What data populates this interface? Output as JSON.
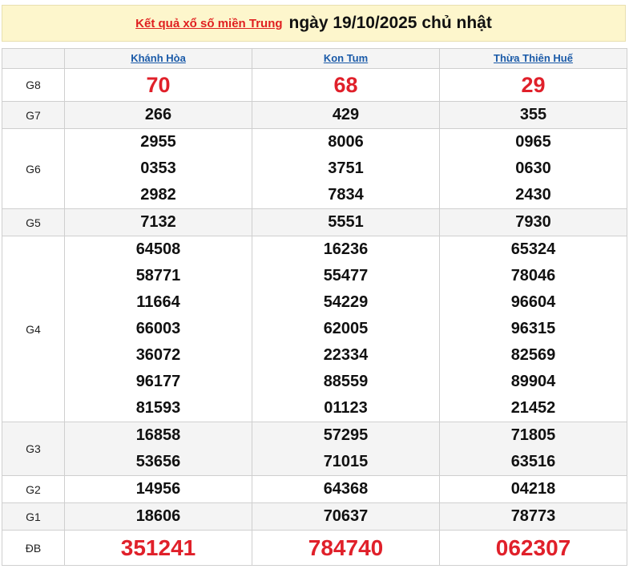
{
  "header": {
    "link_text": "Kết quả xổ số miền Trung",
    "date_text": "ngày 19/10/2025 chủ nhật"
  },
  "provinces": [
    "Khánh Hòa",
    "Kon Tum",
    "Thừa Thiên Huế"
  ],
  "rows": {
    "g8": {
      "label": "G8",
      "values": [
        "70",
        "68",
        "29"
      ]
    },
    "g7": {
      "label": "G7",
      "values": [
        "266",
        "429",
        "355"
      ]
    },
    "g6": {
      "label": "G6",
      "values": [
        [
          "2955",
          "0353",
          "2982"
        ],
        [
          "8006",
          "3751",
          "7834"
        ],
        [
          "0965",
          "0630",
          "2430"
        ]
      ]
    },
    "g5": {
      "label": "G5",
      "values": [
        "7132",
        "5551",
        "7930"
      ]
    },
    "g4": {
      "label": "G4",
      "values": [
        [
          "64508",
          "58771",
          "11664",
          "66003",
          "36072",
          "96177",
          "81593"
        ],
        [
          "16236",
          "55477",
          "54229",
          "62005",
          "22334",
          "88559",
          "01123"
        ],
        [
          "65324",
          "78046",
          "96604",
          "96315",
          "82569",
          "89904",
          "21452"
        ]
      ]
    },
    "g3": {
      "label": "G3",
      "values": [
        [
          "16858",
          "53656"
        ],
        [
          "57295",
          "71015"
        ],
        [
          "71805",
          "63516"
        ]
      ]
    },
    "g2": {
      "label": "G2",
      "values": [
        "14956",
        "64368",
        "04218"
      ]
    },
    "g1": {
      "label": "G1",
      "values": [
        "18606",
        "70637",
        "78773"
      ]
    },
    "db": {
      "label": "ĐB",
      "values": [
        "351241",
        "784740",
        "062307"
      ]
    }
  },
  "colors": {
    "accent_red": "#e0202a",
    "link_blue": "#1a5aa8",
    "header_bg": "#fdf6cc"
  }
}
